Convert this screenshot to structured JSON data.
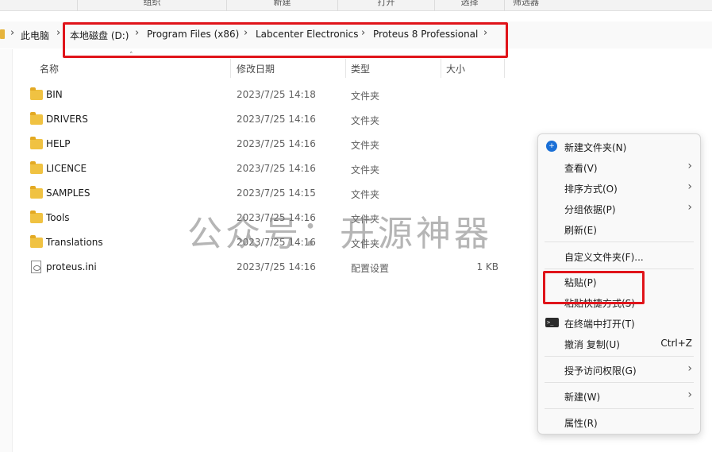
{
  "ribbon": {
    "groups": [
      "组织",
      "新建",
      "打开",
      "选择",
      "筛选器"
    ]
  },
  "breadcrumb": {
    "items": [
      "此电脑",
      "本地磁盘 (D:)",
      "Program Files (x86)",
      "Labcenter Electronics",
      "Proteus 8 Professional"
    ],
    "separator": "›"
  },
  "columns": {
    "name": "名称",
    "date": "修改日期",
    "type": "类型",
    "size": "大小"
  },
  "files": [
    {
      "name": "BIN",
      "date": "2023/7/25 14:18",
      "type": "文件夹",
      "size": "",
      "icon": "folder-icon"
    },
    {
      "name": "DRIVERS",
      "date": "2023/7/25 14:16",
      "type": "文件夹",
      "size": "",
      "icon": "folder-icon"
    },
    {
      "name": "HELP",
      "date": "2023/7/25 14:16",
      "type": "文件夹",
      "size": "",
      "icon": "folder-icon"
    },
    {
      "name": "LICENCE",
      "date": "2023/7/25 14:16",
      "type": "文件夹",
      "size": "",
      "icon": "folder-icon"
    },
    {
      "name": "SAMPLES",
      "date": "2023/7/25 14:15",
      "type": "文件夹",
      "size": "",
      "icon": "folder-icon"
    },
    {
      "name": "Tools",
      "date": "2023/7/25 14:16",
      "type": "文件夹",
      "size": "",
      "icon": "folder-icon"
    },
    {
      "name": "Translations",
      "date": "2023/7/25 14:16",
      "type": "文件夹",
      "size": "",
      "icon": "folder-icon"
    },
    {
      "name": "proteus.ini",
      "date": "2023/7/25 14:16",
      "type": "配置设置",
      "size": "1 KB",
      "icon": "settings-file-icon"
    }
  ],
  "watermark": "公众号：开源神器",
  "context_menu": {
    "items": [
      {
        "label": "新建文件夹(N)",
        "shortcut": "",
        "submenu": false,
        "icon": "new-folder-icon"
      },
      {
        "label": "查看(V)",
        "shortcut": "",
        "submenu": true
      },
      {
        "label": "排序方式(O)",
        "shortcut": "",
        "submenu": true
      },
      {
        "label": "分组依据(P)",
        "shortcut": "",
        "submenu": true
      },
      {
        "label": "刷新(E)",
        "shortcut": "",
        "submenu": false
      },
      {
        "label": "自定义文件夹(F)...",
        "shortcut": "",
        "submenu": false
      },
      {
        "label": "粘贴(P)",
        "shortcut": "",
        "submenu": false
      },
      {
        "label": "粘贴快捷方式(S)",
        "shortcut": "",
        "submenu": false
      },
      {
        "label": "在终端中打开(T)",
        "shortcut": "",
        "submenu": false,
        "icon": "terminal-icon"
      },
      {
        "label": "撤消 复制(U)",
        "shortcut": "Ctrl+Z",
        "submenu": false
      },
      {
        "label": "授予访问权限(G)",
        "shortcut": "",
        "submenu": true
      },
      {
        "label": "新建(W)",
        "shortcut": "",
        "submenu": true
      },
      {
        "label": "属性(R)",
        "shortcut": "",
        "submenu": false
      }
    ]
  },
  "colors": {
    "highlight": "#e0141a",
    "folder": "#f0c242",
    "accent": "#1a6fd6"
  }
}
